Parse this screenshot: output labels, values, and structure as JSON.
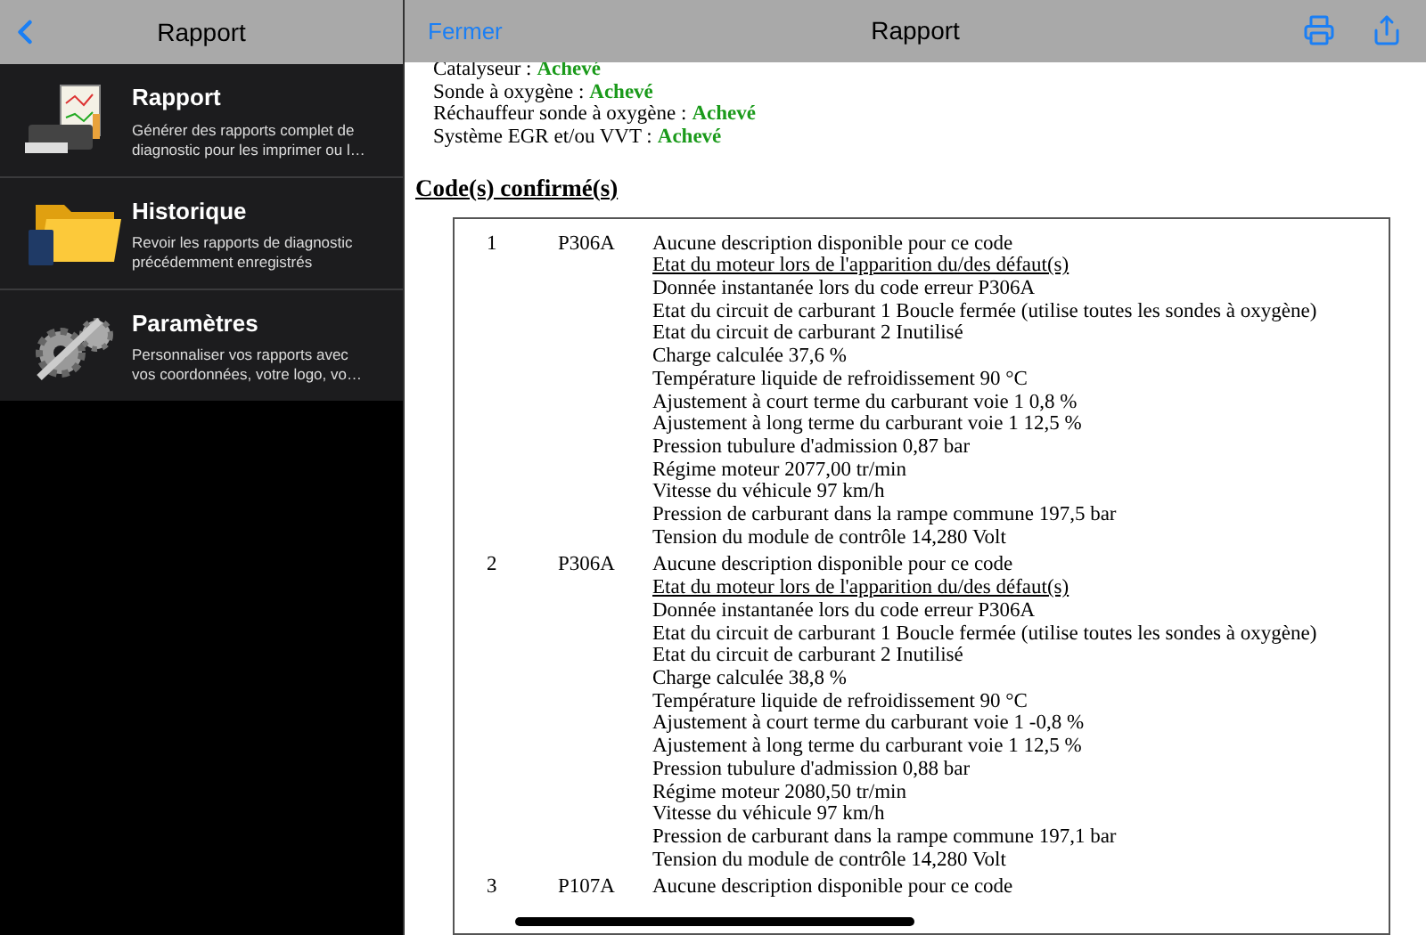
{
  "sidebar": {
    "title": "Rapport",
    "items": [
      {
        "title": "Rapport",
        "description": "Générer des rapports complet de diagnostic pour les imprimer ou l…",
        "kind": "printer"
      },
      {
        "title": "Historique",
        "description": "Revoir les rapports de diagnostic précédemment enregistrés",
        "kind": "folder"
      },
      {
        "title": "Paramètres",
        "description": "Personnaliser vos rapports avec vos coordonnées, votre logo, vo…",
        "kind": "settings"
      }
    ]
  },
  "report": {
    "close": "Fermer",
    "title": "Rapport",
    "monitors": [
      {
        "label": "Catalyseur :",
        "status": "Achevé"
      },
      {
        "label": "Sonde à oxygène :",
        "status": "Achevé"
      },
      {
        "label": "Réchauffeur sonde à oxygène :",
        "status": "Achevé"
      },
      {
        "label": "Système EGR et/ou VVT :",
        "status": "Achevé"
      }
    ],
    "section_title": "Code(s) confirmé(s)",
    "codes": [
      {
        "index": "1",
        "code": "P306A",
        "description": "Aucune description disponible pour ce code",
        "freeze_frame_title": "Etat du moteur lors de l'apparition du/des défaut(s)",
        "details": [
          "Donnée instantanée lors du code erreur P306A",
          "Etat du circuit de carburant 1 Boucle fermée (utilise toutes les sondes à oxygène)",
          "Etat du circuit de carburant 2 Inutilisé",
          "Charge calculée 37,6 %",
          "Température liquide de refroidissement 90 °C",
          "Ajustement à court terme du carburant voie 1 0,8 %",
          "Ajustement à long terme du carburant voie 1 12,5 %",
          "Pression tubulure d'admission 0,87 bar",
          "Régime moteur 2077,00 tr/min",
          "Vitesse du véhicule 97 km/h",
          "Pression de carburant dans la rampe commune 197,5 bar",
          "Tension du module de contrôle 14,280 Volt"
        ]
      },
      {
        "index": "2",
        "code": "P306A",
        "description": "Aucune description disponible pour ce code",
        "freeze_frame_title": "Etat du moteur lors de l'apparition du/des défaut(s)",
        "details": [
          "Donnée instantanée lors du code erreur P306A",
          "Etat du circuit de carburant 1 Boucle fermée (utilise toutes les sondes à oxygène)",
          "Etat du circuit de carburant 2 Inutilisé",
          "Charge calculée 38,8 %",
          "Température liquide de refroidissement 90 °C",
          "Ajustement à court terme du carburant voie 1 -0,8 %",
          "Ajustement à long terme du carburant voie 1 12,5 %",
          "Pression tubulure d'admission 0,88 bar",
          "Régime moteur 2080,50 tr/min",
          "Vitesse du véhicule 97 km/h",
          "Pression de carburant dans la rampe commune 197,1 bar",
          "Tension du module de contrôle 14,280 Volt"
        ]
      },
      {
        "index": "3",
        "code": "P107A",
        "description": "Aucune description disponible pour ce code"
      }
    ]
  }
}
